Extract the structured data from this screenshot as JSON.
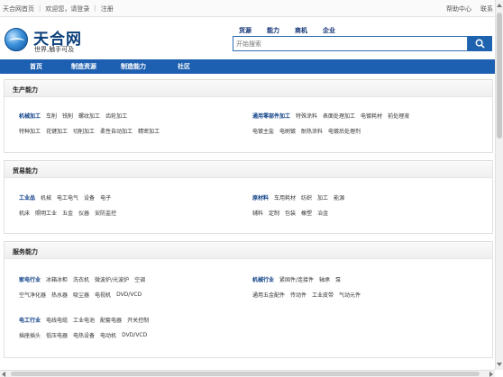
{
  "topbar": {
    "home": "天合网首页",
    "welcome": "欢迎您，请登录",
    "register": "注册",
    "help": "帮助中心",
    "contact": "联系"
  },
  "logo": {
    "title": "天合网",
    "subtitle": "世界,触手可及"
  },
  "search": {
    "tabs": [
      "货源",
      "能力",
      "商机",
      "企业"
    ],
    "placeholder": "开始搜索"
  },
  "nav": [
    "首页",
    "制造资源",
    "制造能力",
    "社区"
  ],
  "sections": [
    {
      "title": "生产能力",
      "left": [
        [
          "机械加工",
          "车削",
          "铣削",
          "螺纹加工",
          "齿轮加工"
        ],
        [
          "特种加工",
          "花键加工",
          "切削加工",
          "柔性自动加工",
          "精密加工"
        ]
      ],
      "right": [
        [
          "通用零部件加工",
          "特殊涂料",
          "表面处理加工",
          "电镀耗材",
          "前处理液"
        ],
        [
          "电镀主盐",
          "电刷镀",
          "耐热涂料",
          "电镀后处理剂"
        ]
      ]
    },
    {
      "title": "贸易能力",
      "left": [
        [
          "工业品",
          "机械",
          "电工电气",
          "设备",
          "电子"
        ],
        [
          "机床",
          "照明工业",
          "五金",
          "仪器",
          "安防监控"
        ]
      ],
      "right": [
        [
          "原材料",
          "车用耗材",
          "纺织",
          "加工",
          "能源"
        ],
        [
          "辅料",
          "定制",
          "包装",
          "橡塑",
          "冶金"
        ]
      ]
    },
    {
      "title": "服务能力",
      "left": [
        [
          "家电行业",
          "冰箱冰柜",
          "洗衣机",
          "微波炉/光波炉",
          "空调"
        ],
        [
          "空气净化器",
          "热水器",
          "吸尘器",
          "电视机",
          "DVD/VCD"
        ],
        [
          "电工行业",
          "电线电缆",
          "工业电池",
          "配套电器",
          "开关控制"
        ],
        [
          "插座插头",
          "低压电器",
          "电热设备",
          "电动机",
          "DVD/VCD"
        ]
      ],
      "right": [
        [
          "机械行业",
          "紧固件/连接件",
          "轴承",
          "泵"
        ],
        [
          "通用五金配件",
          "传动件",
          "工业皮带",
          "气动元件"
        ]
      ]
    }
  ]
}
